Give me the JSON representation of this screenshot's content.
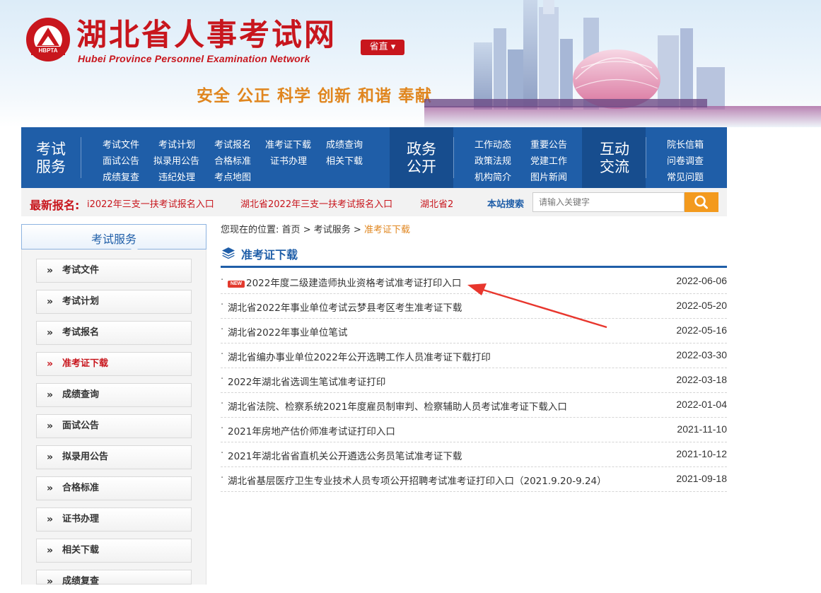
{
  "header": {
    "title": "湖北省人事考试网",
    "subtitle": "Hubei Province Personnel Examination Network",
    "logo_text": "HBPTA",
    "region_button": "省直 ▾",
    "slogan": "安全 公正 科学 创新 和谐 奉献"
  },
  "nav": {
    "exam_service": {
      "title": "考试\n服务",
      "links": [
        "考试文件",
        "考试计划",
        "考试报名",
        "准考证下载",
        "成绩查询",
        "面试公告",
        "拟录用公告",
        "合格标准",
        "证书办理",
        "相关下载",
        "成绩复查",
        "违纪处理",
        "考点地图"
      ]
    },
    "gov_open": {
      "title": "政务\n公开",
      "links": [
        "工作动态",
        "重要公告",
        "政策法规",
        "党建工作",
        "机构简介",
        "图片新闻"
      ]
    },
    "interact": {
      "title": "互动\n交流",
      "links": [
        "院长信箱",
        "问卷调查",
        "常见问题"
      ]
    }
  },
  "latest": {
    "label": "最新报名:",
    "items": [
      "i2022年三支一扶考试报名入口",
      "湖北省2022年三支一扶考试报名入口",
      "湖北省2"
    ]
  },
  "search": {
    "label": "本站搜索",
    "placeholder": "请输入关键字"
  },
  "sidebar": {
    "title": "考试服务",
    "items": [
      "考试文件",
      "考试计划",
      "考试报名",
      "准考证下载",
      "成绩查询",
      "面试公告",
      "拟录用公告",
      "合格标准",
      "证书办理",
      "相关下载",
      "成绩复查"
    ],
    "active_index": 3
  },
  "breadcrumb": {
    "prefix": "您现在的位置:",
    "home": "首页",
    "sep": ">",
    "section": "考试服务",
    "current": "准考证下载"
  },
  "section_title": "准考证下载",
  "articles": [
    {
      "title": "2022年度二级建造师执业资格考试准考证打印入口",
      "date": "2022-06-06",
      "badge": "NEW"
    },
    {
      "title": "湖北省2022年事业单位考试云梦县考区考生准考证下载",
      "date": "2022-05-20"
    },
    {
      "title": "湖北省2022年事业单位笔试",
      "date": "2022-05-16"
    },
    {
      "title": "湖北省编办事业单位2022年公开选聘工作人员准考证下载打印",
      "date": "2022-03-30"
    },
    {
      "title": "2022年湖北省选调生笔试准考证打印",
      "date": "2022-03-18"
    },
    {
      "title": "湖北省法院、检察系统2021年度雇员制审判、检察辅助人员考试准考证下载入口",
      "date": "2022-01-04"
    },
    {
      "title": "2021年房地产估价师准考试证打印入口",
      "date": "2021-11-10"
    },
    {
      "title": "2021年湖北省省直机关公开遴选公务员笔试准考证下载",
      "date": "2021-10-12"
    },
    {
      "title": "湖北省基层医疗卫生专业技术人员专项公开招聘考试准考证打印入口（2021.9.20-9.24）",
      "date": "2021-09-18"
    }
  ],
  "colors": {
    "brand_red": "#c8161d",
    "nav_blue": "#1f5ea8",
    "accent_orange": "#f39a1e",
    "annotation_arrow": "#e8362d"
  }
}
